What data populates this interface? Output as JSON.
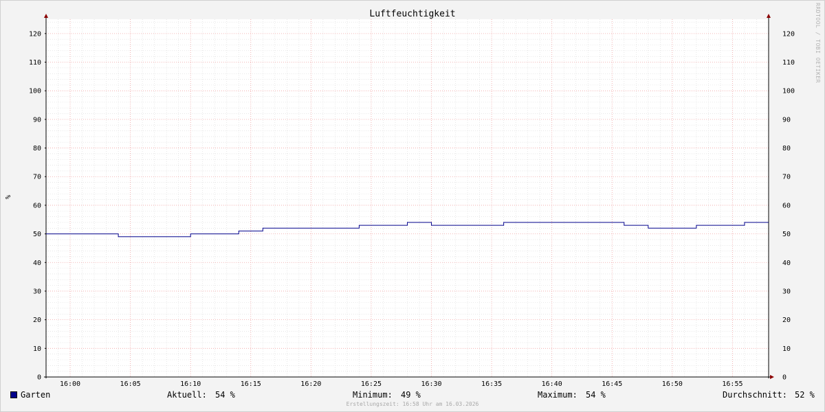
{
  "watermark": "RRDTOOL / TOBI OETIKER",
  "chart_data": {
    "type": "line",
    "title": "Luftfeuchtigkeit",
    "ylabel": "%",
    "ylim": [
      0,
      125
    ],
    "yticks": [
      0,
      10,
      20,
      30,
      40,
      50,
      60,
      70,
      80,
      90,
      100,
      110,
      120
    ],
    "xlabels": [
      "16:00",
      "16:05",
      "16:10",
      "16:15",
      "16:20",
      "16:25",
      "16:30",
      "16:35",
      "16:40",
      "16:45",
      "16:50",
      "16:55"
    ],
    "xrange": [
      "15:58",
      "16:58"
    ],
    "series": [
      {
        "name": "Garten",
        "color": "#00008b",
        "step": true,
        "x": [
          "15:58",
          "16:04",
          "16:10",
          "16:14",
          "16:16",
          "16:24",
          "16:28",
          "16:30",
          "16:36",
          "16:46",
          "16:48",
          "16:52",
          "16:56",
          "16:58"
        ],
        "values": [
          50,
          49,
          50,
          51,
          52,
          53,
          54,
          53,
          54,
          53,
          52,
          53,
          54,
          54
        ]
      }
    ],
    "grid": true
  },
  "legend": {
    "series_name": "Garten",
    "current_label": "Aktuell:",
    "current_value": "54 %",
    "min_label": "Minimum:",
    "min_value": "49 %",
    "max_label": "Maximum:",
    "max_value": "54 %",
    "avg_label": "Durchschnitt:",
    "avg_value": "52 %"
  },
  "footer": "Erstellungszeit: 16:58 Uhr am 16.03.2026"
}
